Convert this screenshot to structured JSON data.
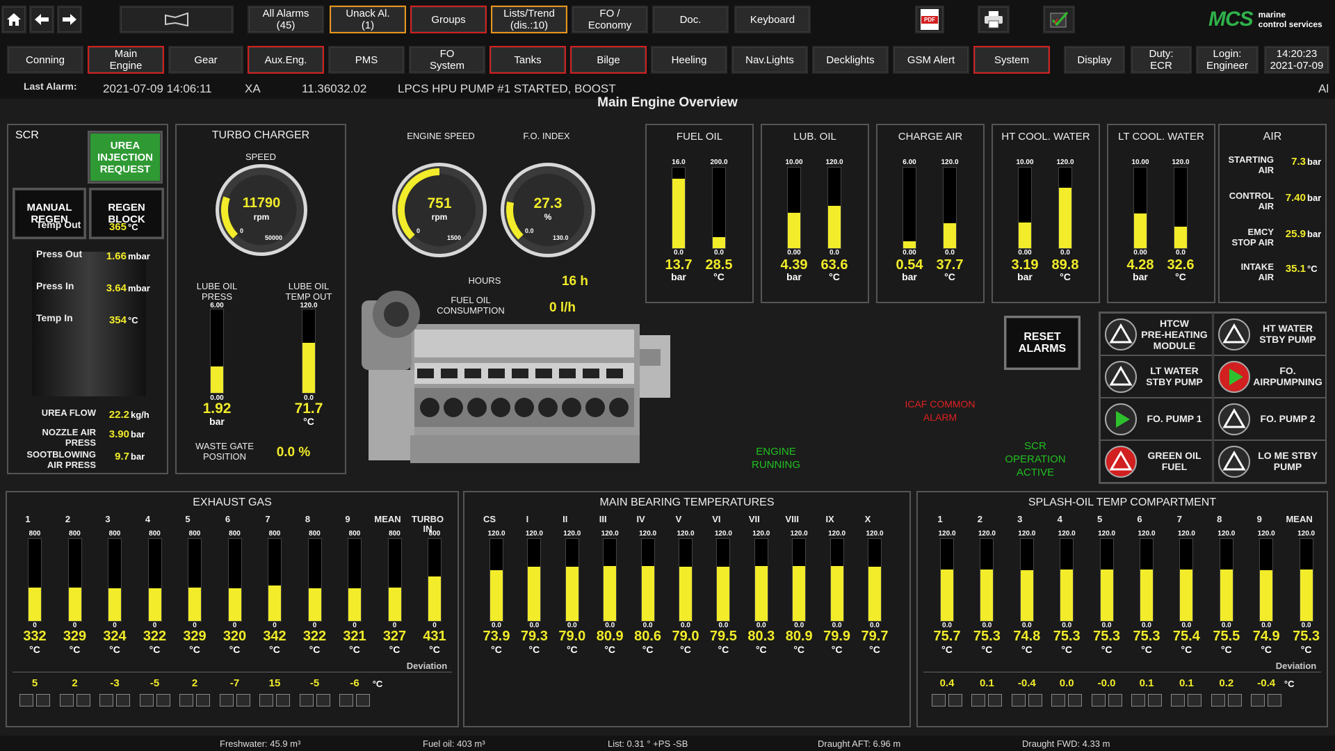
{
  "top_row1": [
    {
      "label": "All Alarms\n(45)",
      "style": ""
    },
    {
      "label": "Unack Al.\n(1)",
      "style": "orange"
    },
    {
      "label": "Groups",
      "style": "red"
    },
    {
      "label": "Lists/Trend\n(dis.:10)",
      "style": "orange"
    },
    {
      "label": "FO /\nEconomy",
      "style": ""
    },
    {
      "label": "Doc.",
      "style": ""
    },
    {
      "label": "Keyboard",
      "style": ""
    }
  ],
  "top_row2": [
    {
      "label": "Conning",
      "style": ""
    },
    {
      "label": "Main\nEngine",
      "style": "red"
    },
    {
      "label": "Gear",
      "style": ""
    },
    {
      "label": "Aux.Eng.",
      "style": "red"
    },
    {
      "label": "PMS",
      "style": ""
    },
    {
      "label": "FO\nSystem",
      "style": ""
    },
    {
      "label": "Tanks",
      "style": "red"
    },
    {
      "label": "Bilge",
      "style": "red"
    },
    {
      "label": "Heeling",
      "style": ""
    },
    {
      "label": "Nav.Lights",
      "style": ""
    },
    {
      "label": "Decklights",
      "style": ""
    },
    {
      "label": "GSM Alert",
      "style": ""
    },
    {
      "label": "System",
      "style": "red"
    },
    {
      "label": "Display",
      "style": ""
    },
    {
      "label": "Duty:\nECR",
      "style": ""
    },
    {
      "label": "Login:\nEngineer",
      "style": ""
    },
    {
      "label": "14:20:23\n2021-07-09",
      "style": ""
    }
  ],
  "logo": {
    "mark": "MCS",
    "line1": "marine",
    "line2": "control services"
  },
  "icons": {
    "pdf": "PDF"
  },
  "last_alarm": {
    "label": "Last Alarm:",
    "time": "2021-07-09 14:06:11",
    "tag": "XA",
    "code": "11.36032.02",
    "text": "LPCS HPU PUMP #1 STARTED, BOOST",
    "right": "Al"
  },
  "page_title": "Main Engine Overview",
  "scr": {
    "title": "SCR",
    "urea_btn": "UREA\nINJECTION\nREQUEST",
    "manual": "MANUAL\nREGEN",
    "regen": "REGEN\nBLOCK",
    "rows": [
      {
        "label": "Temp Out",
        "value": "365",
        "unit": "°C"
      },
      {
        "label": "Press Out",
        "value": "1.66",
        "unit": "mbar"
      },
      {
        "label": "Press In",
        "value": "3.64",
        "unit": "mbar"
      },
      {
        "label": "Temp In",
        "value": "354",
        "unit": "°C"
      }
    ],
    "bottom": [
      {
        "label": "UREA FLOW",
        "value": "22.2",
        "unit": "kg/h"
      },
      {
        "label": "NOZZLE AIR\nPRESS",
        "value": "3.90",
        "unit": "bar"
      },
      {
        "label": "SOOTBLOWING\nAIR PRESS",
        "value": "9.7",
        "unit": "bar"
      }
    ]
  },
  "turbo": {
    "title": "TURBO CHARGER",
    "speed_label": "SPEED",
    "speed": "11790",
    "speed_unit": "rpm",
    "speed_min": "0",
    "speed_max": "50000",
    "speed_level": 0.24,
    "lube_press_label": "LUBE OIL\nPRESS",
    "lube_press": "1.92",
    "lube_press_unit": "bar",
    "lube_press_max": "6.00",
    "lube_press_min": "0.00",
    "lube_press_level": 0.32,
    "lube_temp_label": "LUBE OIL\nTEMP OUT",
    "lube_temp": "71.7",
    "lube_temp_unit": "°C",
    "lube_temp_max": "120.0",
    "lube_temp_min": "0.0",
    "lube_temp_level": 0.6,
    "waste_label": "WASTE GATE\nPOSITION",
    "waste": "0.0 %"
  },
  "engine": {
    "speed_label": "ENGINE SPEED",
    "speed": "751",
    "speed_unit": "rpm",
    "speed_min": "0",
    "speed_max": "1500",
    "speed_level": 0.5,
    "fo_label": "F.O. INDEX",
    "fo": "27.3",
    "fo_unit": "%",
    "fo_min": "0.0",
    "fo_max": "130.0",
    "fo_level": 0.21,
    "hours_label": "HOURS",
    "hours": "16 h",
    "cons_label": "FUEL OIL\nCONSUMPTION",
    "cons": "0 l/h"
  },
  "fluid_panels": [
    {
      "title": "FUEL OIL",
      "bars": [
        {
          "max": "16.0",
          "min": "0.0",
          "value": "13.7",
          "unit": "bar",
          "level": 0.86
        },
        {
          "max": "200.0",
          "min": "0.0",
          "value": "28.5",
          "unit": "°C",
          "level": 0.14
        }
      ]
    },
    {
      "title": "LUB. OIL",
      "bars": [
        {
          "max": "10.00",
          "min": "0.00",
          "value": "4.39",
          "unit": "bar",
          "level": 0.44
        },
        {
          "max": "120.0",
          "min": "0.0",
          "value": "63.6",
          "unit": "°C",
          "level": 0.53
        }
      ]
    },
    {
      "title": "CHARGE AIR",
      "bars": [
        {
          "max": "6.00",
          "min": "0.00",
          "value": "0.54",
          "unit": "bar",
          "level": 0.09
        },
        {
          "max": "120.0",
          "min": "0.0",
          "value": "37.7",
          "unit": "°C",
          "level": 0.31
        }
      ]
    },
    {
      "title": "HT COOL. WATER",
      "bars": [
        {
          "max": "10.00",
          "min": "0.00",
          "value": "3.19",
          "unit": "bar",
          "level": 0.32
        },
        {
          "max": "120.0",
          "min": "0.0",
          "value": "89.8",
          "unit": "°C",
          "level": 0.75
        }
      ]
    },
    {
      "title": "LT COOL. WATER",
      "bars": [
        {
          "max": "10.00",
          "min": "0.00",
          "value": "4.28",
          "unit": "bar",
          "level": 0.43
        },
        {
          "max": "120.0",
          "min": "0.0",
          "value": "32.6",
          "unit": "°C",
          "level": 0.27
        }
      ]
    }
  ],
  "air": {
    "title": "AIR",
    "rows": [
      {
        "label": "STARTING\nAIR",
        "value": "7.3",
        "unit": "bar"
      },
      {
        "label": "CONTROL\nAIR",
        "value": "7.40",
        "unit": "bar"
      },
      {
        "label": "EMCY\nSTOP AIR",
        "value": "25.9",
        "unit": "bar"
      },
      {
        "label": "INTAKE\nAIR",
        "value": "35.1",
        "unit": "°C"
      }
    ]
  },
  "reset_btn": "RESET\nALARMS",
  "status": {
    "icaf": "ICAF COMMON\nALARM",
    "engine_running": "ENGINE\nRUNNING",
    "scr_active": "SCR\nOPERATION\nACTIVE"
  },
  "pumps": [
    {
      "label": "HTCW\nPRE-HEATING\nMODULE",
      "state": "off"
    },
    {
      "label": "HT WATER\nSTBY PUMP",
      "state": "off"
    },
    {
      "label": "LT WATER\nSTBY PUMP",
      "state": "off"
    },
    {
      "label": "FO.\nAIRPUMPNING",
      "state": "run_red"
    },
    {
      "label": "FO. PUMP 1",
      "state": "run"
    },
    {
      "label": "FO. PUMP 2",
      "state": "off"
    },
    {
      "label": "GREEN OIL\nFUEL",
      "state": "alarm"
    },
    {
      "label": "LO ME STBY\nPUMP",
      "state": "off"
    }
  ],
  "exhaust": {
    "title": "EXHAUST GAS",
    "cols": [
      "1",
      "2",
      "3",
      "4",
      "5",
      "6",
      "7",
      "8",
      "9",
      "MEAN",
      "TURBO\nIN"
    ],
    "max": "800",
    "min": "0",
    "values": [
      "332",
      "329",
      "324",
      "322",
      "329",
      "320",
      "342",
      "322",
      "321",
      "327",
      "431"
    ],
    "unit": "°C",
    "levels": [
      0.41,
      0.41,
      0.4,
      0.4,
      0.41,
      0.4,
      0.43,
      0.4,
      0.4,
      0.41,
      0.54
    ],
    "dev_label": "Deviation",
    "deviations": [
      "5",
      "2",
      "-3",
      "-5",
      "2",
      "-7",
      "15",
      "-5",
      "-6"
    ],
    "dev_unit": "°C"
  },
  "bearing": {
    "title": "MAIN BEARING TEMPERATURES",
    "cols": [
      "CS",
      "I",
      "II",
      "III",
      "IV",
      "V",
      "VI",
      "VII",
      "VIII",
      "IX",
      "X"
    ],
    "max": "120.0",
    "min": "0.0",
    "values": [
      "73.9",
      "79.3",
      "79.0",
      "80.9",
      "80.6",
      "79.0",
      "79.5",
      "80.3",
      "80.9",
      "79.9",
      "79.7"
    ],
    "unit": "°C",
    "levels": [
      0.62,
      0.66,
      0.66,
      0.67,
      0.67,
      0.66,
      0.66,
      0.67,
      0.67,
      0.67,
      0.66
    ]
  },
  "splash": {
    "title": "SPLASH-OIL TEMP COMPARTMENT",
    "cols": [
      "1",
      "2",
      "3",
      "4",
      "5",
      "6",
      "7",
      "8",
      "9",
      "MEAN"
    ],
    "max": "120.0",
    "min": "0.0",
    "values": [
      "75.7",
      "75.3",
      "74.8",
      "75.3",
      "75.3",
      "75.3",
      "75.4",
      "75.5",
      "74.9",
      "75.3"
    ],
    "unit": "°C",
    "levels": [
      0.63,
      0.63,
      0.62,
      0.63,
      0.63,
      0.63,
      0.63,
      0.63,
      0.62,
      0.63
    ],
    "dev_label": "Deviation",
    "deviations": [
      "0.4",
      "0.1",
      "-0.4",
      "0.0",
      "-0.0",
      "0.1",
      "0.1",
      "0.2",
      "-0.4"
    ],
    "dev_unit": "°C"
  },
  "footer": {
    "fresh": "Freshwater: 45.9 m³",
    "fuel": "Fuel oil: 403 m³",
    "list": "List: 0.31 ° +PS -SB",
    "aft": "Draught AFT: 6.96 m",
    "fwd": "Draught FWD: 4.33 m"
  },
  "colors": {
    "yellow": "#f2ec2a",
    "red_border": "#d21f1f",
    "orange_border": "#e8951a",
    "green": "#20c020",
    "red_text": "#e02020"
  }
}
